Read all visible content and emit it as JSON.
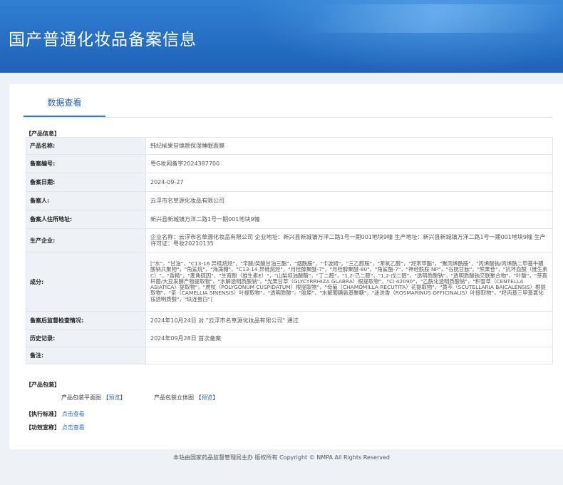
{
  "banner": {
    "title": "国产普通化妆品备案信息"
  },
  "tabs": [
    {
      "label": "数据查看"
    }
  ],
  "product_section": {
    "title": "【产品信息】"
  },
  "rows": [
    {
      "key": "产品名称:",
      "value": "韩纪榆果苷焕颜保湿睡眠面膜"
    },
    {
      "key": "备案编号:",
      "value": "粤G妆网备字2024387700"
    },
    {
      "key": "备案日期:",
      "value": "2024-09-27"
    },
    {
      "key": "备案人:",
      "value": "云浮市名草源化妆品有限公司"
    },
    {
      "key": "备案人住所地址:",
      "value": "新兴县新城镇万洋二路1号一期001地块9幢"
    },
    {
      "key": "生产企业:",
      "value": "企业名称：云浮市名草源化妆品有限公司 企业地址：新兴县新城镇万洋二路1号一期001地块9幢 生产地址：新兴县新城镇万洋二路1号一期001地块9幢 生产许可证：粤妆20210135"
    },
    {
      "key": "成分:",
      "value": "[\"水\"，\"甘油\"，\"C13-16 异链烷烃\"，\"辛酸/癸酸甘油三酯\"，\"烟酰胺\"，\"卡波姆\"，\"三乙醇胺\"，\"苯氧乙醇\"，\"羟苯甲酯\"，\"聚丙烯酰胺\"，\"丙烯酸钠/丙烯酰二甲基牛磺酸钠共聚物\"，\"角鲨烷\"，\"海藻糖\"，\"C13-14 异链烷烃\"，\"月桂醇聚醚-7\"，\"月桂醇聚醚-80\"，\"角鲨酯-7\"，\"神经酰胺 NP\"，\"谷胱甘肽\"，\"熊果苷\"，\"抗坏血酸（维生素C）\"，\"香精\"，\"麦角硫因\"，\"生育酚（维生素E）\"，\"山梨坦油酸酯\"，\"丁二醇\"，\"1,2-己二醇\"，\"1,2-戊二醇\"，\"透明质酸钠\"，\"透明质酸钠交联聚合物\"，\"叶酸\"，\"芽孢杆菌/大豆发酵产物提取物\"，\"水解透明质酸钠\"，\"光果甘草（GLYCYRRHIZA GLABRA）根提取物\"，\"CI 42090\"，\"乙酰化透明质酸钠\"，\"积雪草（CENTELLA ASIATICA）提取物\"，\"虎杖（POLYGONUM CUSPIDATUM）根提取物\"，\"母菊（CHAMOMILLA RECUTITA）花提取物\"，\"黄芩（SCUTELLARIA BAICALENSIS）根提取物\"，\"茶（CAMELLIA SINENSIS）叶提取物\"，\"透明质酸\"，\"胶原\"，\"水解葡糖氨基聚糖\"，\"迷迭香（ROSMARINUS OFFICINALIS）叶提取物\"，\"羟丙基三甲基氯化铵透明质酸\"，\"玞连蛋白\"]"
    },
    {
      "key": "备案后监督检查情况:",
      "value": "2024年10月24日 对 \"云浮市名草源化妆品有限公司\" 通过"
    },
    {
      "key": "历史记录:",
      "value": "2024年09月28日 首次备案"
    },
    {
      "key": "备注:",
      "value": ""
    }
  ],
  "packaging": {
    "title": "【产品包装】",
    "flat": {
      "label": "产品包装平面图",
      "bracket_open": "【",
      "link": "预览",
      "bracket_close": "】"
    },
    "solid": {
      "label": "产品包装立体图",
      "bracket_open": "【",
      "link": "预览",
      "bracket_close": "】"
    }
  },
  "standard": {
    "title": "【执行标准】",
    "link": "点击查看"
  },
  "claims": {
    "title": "【功效宣称】",
    "link": "点击查看"
  },
  "footer": {
    "text": "本站由国家药品监督管理局主办 版权所有 Copyright © NMPA All Rights Reserved"
  },
  "colors": {
    "banner": "#2a74c9",
    "link": "#2f6fcc",
    "tab_underline": "#2f7fd2",
    "key_bg": "#eef1f5"
  }
}
